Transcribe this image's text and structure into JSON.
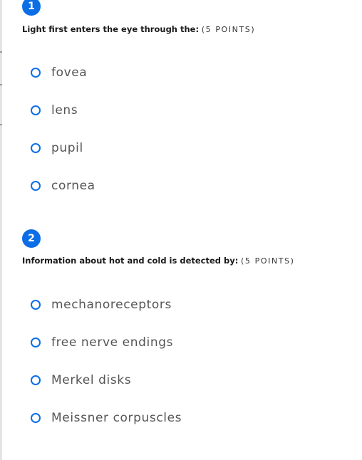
{
  "questions": [
    {
      "number": "1",
      "title": "Light first enters the eye through the:",
      "points": "(5 POINTS)",
      "options": [
        "fovea",
        "lens",
        "pupil",
        "cornea"
      ]
    },
    {
      "number": "2",
      "title": "Information about hot and cold is detected by:",
      "points": "(5 POINTS)",
      "options": [
        "mechanoreceptors",
        "free nerve endings",
        "Merkel disks",
        "Meissner corpuscles"
      ]
    }
  ],
  "colors": {
    "accent": "#0b6ee6",
    "option_text": "#555555",
    "question_text": "#1a1a1a"
  },
  "icons": {
    "radio": "radio-unchecked-icon"
  }
}
